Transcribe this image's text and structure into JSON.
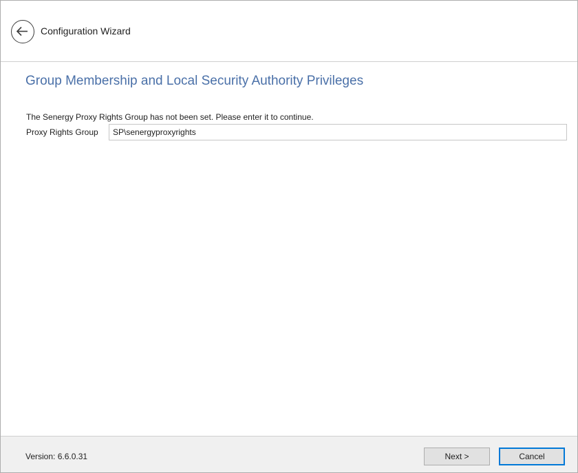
{
  "window": {
    "title": "Configuration Wizard"
  },
  "header": {
    "back_icon": "arrow-left-circle-icon"
  },
  "content": {
    "heading": "Group Membership and Local Security Authority Privileges",
    "message": "The Senergy Proxy Rights Group has not been set. Please enter it to continue.",
    "proxy_group": {
      "label": "Proxy Rights Group",
      "value": "SP\\senergyproxyrights"
    }
  },
  "footer": {
    "version": "Version: 6.6.0.31",
    "next_label": "Next >",
    "cancel_label": "Cancel"
  },
  "colors": {
    "heading": "#4a70a8",
    "footer_bg": "#f0f0f0",
    "focus_border": "#0078d7"
  }
}
